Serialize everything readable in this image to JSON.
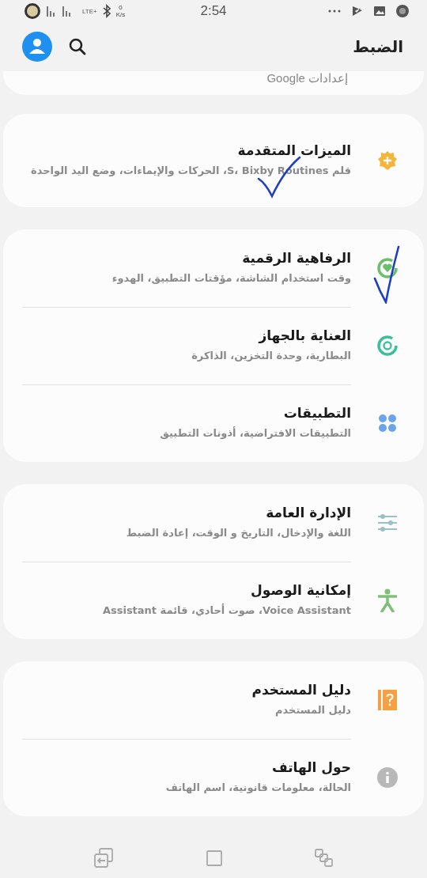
{
  "status_bar": {
    "time": "2:54",
    "network": "LTE+",
    "speed_value": "0",
    "speed_unit": "K/s"
  },
  "header": {
    "title": "الضبط"
  },
  "partial_card": {
    "subtitle": "إعدادات Google"
  },
  "groups": [
    {
      "items": [
        {
          "title": "الميزات المتقدمة",
          "subtitle": "قلم S، Bixby Routines، الحركات والإيماءات، وضع اليد الواحدة"
        }
      ]
    },
    {
      "items": [
        {
          "title": "الرفاهية الرقمية",
          "subtitle": "وقت استخدام الشاشة، مؤقتات التطبيق، الهدوء"
        },
        {
          "title": "العناية بالجهاز",
          "subtitle": "البطارية، وحدة التخزين، الذاكرة"
        },
        {
          "title": "التطبيقات",
          "subtitle": "التطبيقات الافتراضية، أذونات التطبيق"
        }
      ]
    },
    {
      "items": [
        {
          "title": "الإدارة العامة",
          "subtitle": "اللغة والإدخال، التاريخ و الوقت، إعادة الضبط"
        },
        {
          "title": "إمكانية الوصول",
          "subtitle": "Voice Assistant، صوت أحادي، قائمة Assistant"
        }
      ]
    },
    {
      "items": [
        {
          "title": "دليل المستخدم",
          "subtitle": "دليل المستخدم"
        },
        {
          "title": "حول الهاتف",
          "subtitle": "الحالة، معلومات قانونية، اسم الهاتف"
        }
      ]
    }
  ]
}
